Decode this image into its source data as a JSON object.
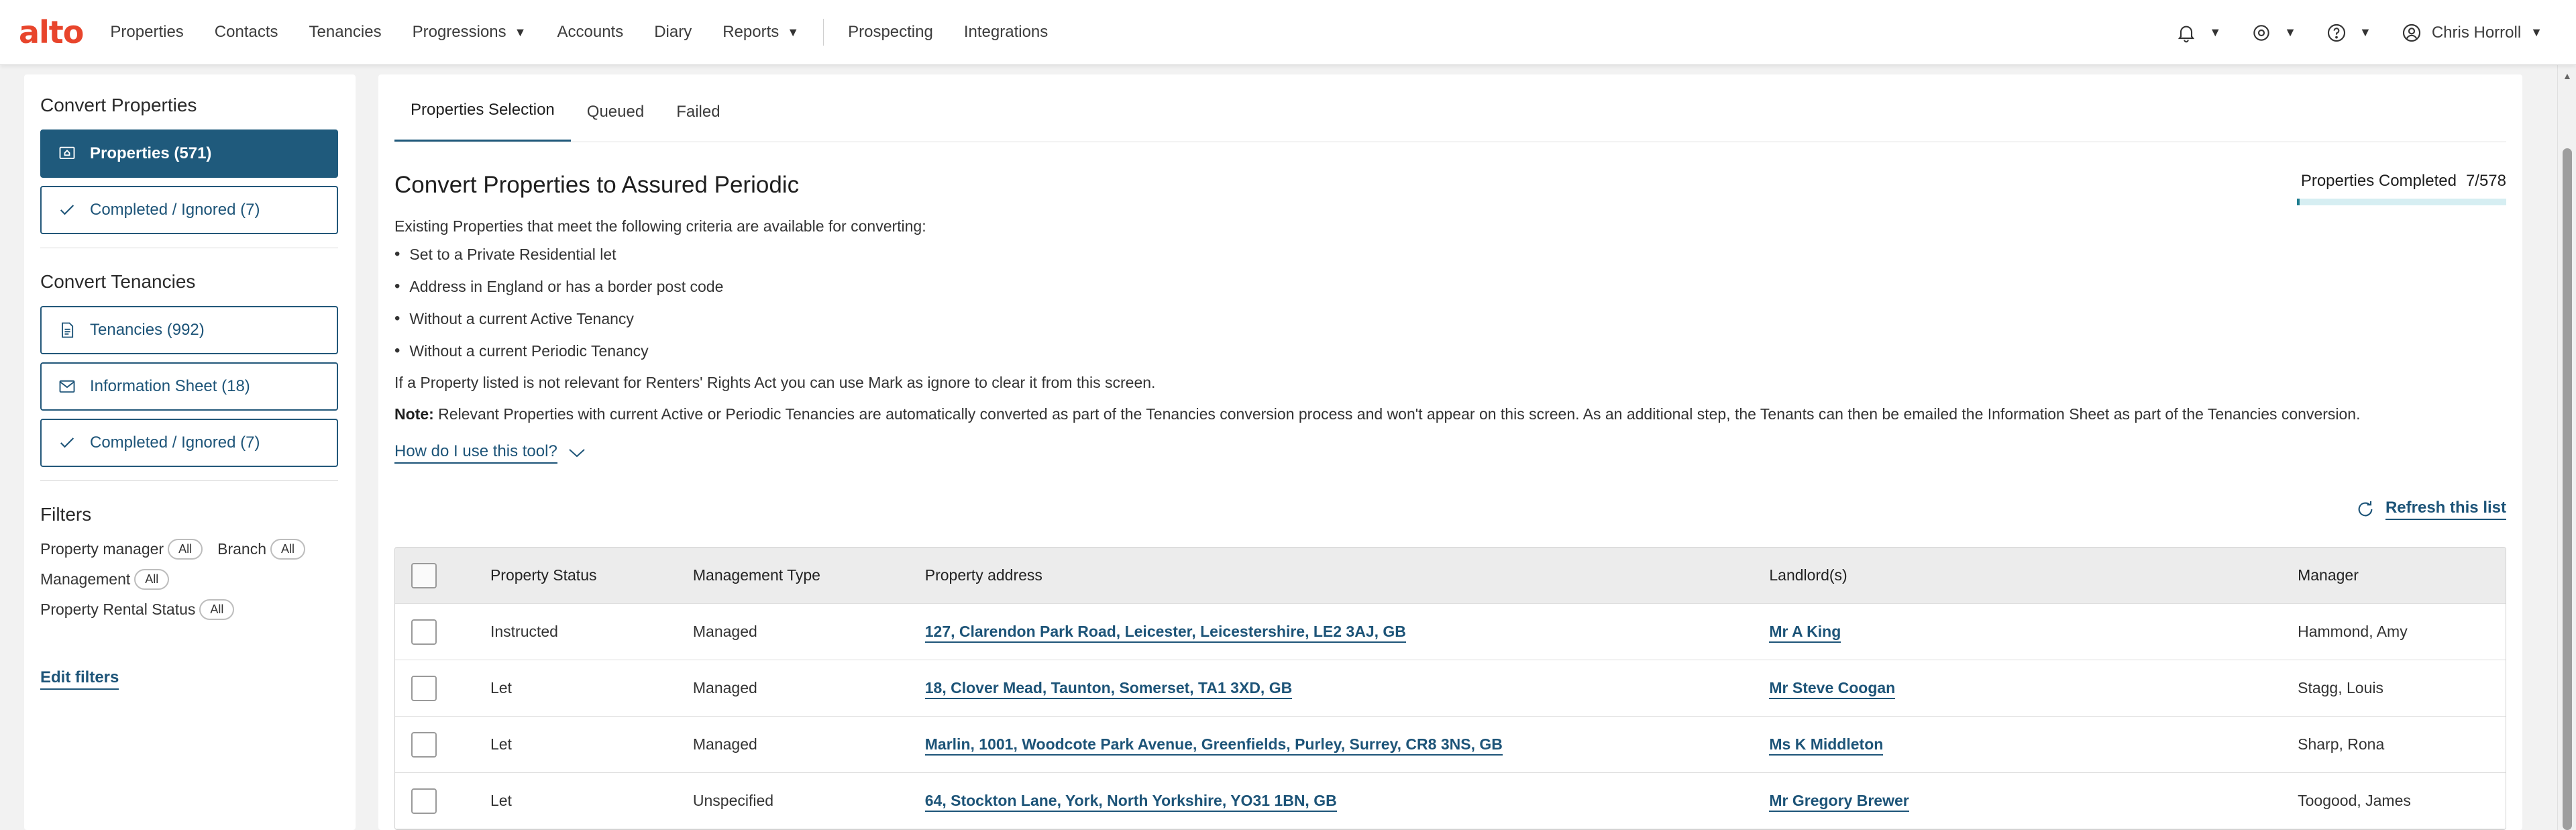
{
  "nav": {
    "logo": "alto",
    "items": [
      {
        "label": "Properties",
        "dropdown": false
      },
      {
        "label": "Contacts",
        "dropdown": false
      },
      {
        "label": "Tenancies",
        "dropdown": false
      },
      {
        "label": "Progressions",
        "dropdown": true
      },
      {
        "label": "Accounts",
        "dropdown": false
      },
      {
        "label": "Diary",
        "dropdown": false
      },
      {
        "label": "Reports",
        "dropdown": true
      },
      {
        "label": "Prospecting",
        "dropdown": false
      },
      {
        "label": "Integrations",
        "dropdown": false
      }
    ],
    "user_name": "Chris Horroll"
  },
  "sidebar": {
    "properties_title": "Convert Properties",
    "properties_btn": "Properties (571)",
    "properties_completed_btn": "Completed / Ignored (7)",
    "tenancies_title": "Convert Tenancies",
    "tenancies_btn": "Tenancies (992)",
    "info_sheet_btn": "Information Sheet (18)",
    "tenancies_completed_btn": "Completed / Ignored (7)",
    "filters_title": "Filters",
    "filters": {
      "property_manager": {
        "label": "Property manager",
        "value": "All"
      },
      "branch": {
        "label": "Branch",
        "value": "All"
      },
      "management": {
        "label": "Management",
        "value": "All"
      },
      "rental_status": {
        "label": "Property Rental Status",
        "value": "All"
      }
    },
    "edit_filters": "Edit filters"
  },
  "main": {
    "tabs": [
      "Properties Selection",
      "Queued",
      "Failed"
    ],
    "title": "Convert Properties to Assured Periodic",
    "progress_label": "Properties Completed",
    "progress_count": "7/578",
    "progress_fraction": 0.0121,
    "criteria_intro": "Existing Properties that meet the following criteria are available for converting:",
    "criteria": [
      "Set to a Private Residential let",
      "Address in England or has a border post code",
      "Without a current Active Tenancy",
      "Without a current Periodic Tenancy"
    ],
    "ignore_text": "If a Property listed is not relevant for Renters' Rights Act you can use Mark as ignore to clear it from this screen.",
    "note_label": "Note:",
    "note_text": " Relevant Properties with current Active or Periodic Tenancies are automatically converted as part of the Tenancies conversion process and won't appear on this screen. As an additional step, the Tenants can then be emailed the Information Sheet as part of the Tenancies conversion.",
    "how_link": "How do I use this tool?",
    "refresh": "Refresh this list"
  },
  "table": {
    "headers": [
      "Property Status",
      "Management Type",
      "Property address",
      "Landlord(s)",
      "Manager"
    ],
    "rows": [
      {
        "status": "Instructed",
        "management": "Managed",
        "address": "127, Clarendon Park Road, Leicester, Leicestershire, LE2 3AJ, GB",
        "landlord": "Mr A King",
        "manager": "Hammond, Amy"
      },
      {
        "status": "Let",
        "management": "Managed",
        "address": "18, Clover Mead, Taunton, Somerset, TA1 3XD, GB",
        "landlord": "Mr Steve Coogan",
        "manager": "Stagg, Louis"
      },
      {
        "status": "Let",
        "management": "Managed",
        "address": "Marlin, 1001, Woodcote Park Avenue, Greenfields, Purley, Surrey, CR8 3NS, GB",
        "landlord": "Ms K Middleton",
        "manager": "Sharp, Rona"
      },
      {
        "status": "Let",
        "management": "Unspecified",
        "address": "64, Stockton Lane, York, North Yorkshire, YO31 1BN, GB",
        "landlord": "Mr Gregory Brewer",
        "manager": "Toogood, James"
      }
    ]
  },
  "colors": {
    "brand": "#e8452c",
    "primary": "#1f5a7c",
    "progress_fill": "#1f7d8f"
  }
}
